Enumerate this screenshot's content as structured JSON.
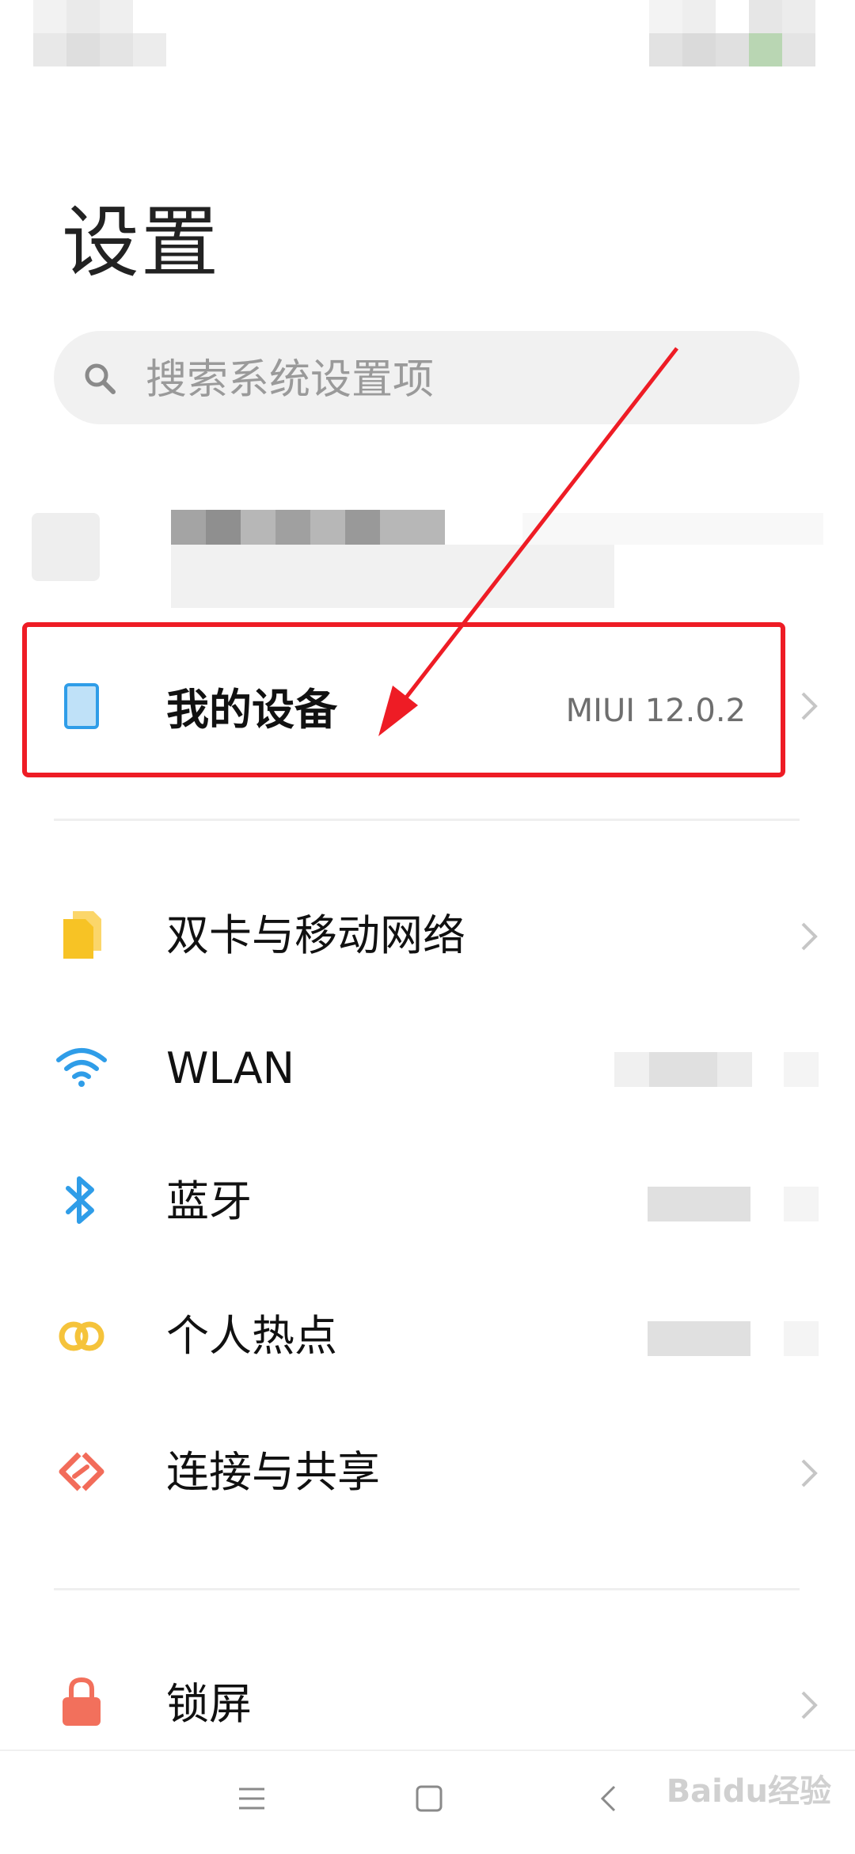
{
  "title": "设置",
  "search": {
    "placeholder": "搜索系统设置项"
  },
  "my_device": {
    "label": "我的设备",
    "value": "MIUI 12.0.2"
  },
  "items": [
    {
      "label": "双卡与移动网络",
      "icon": "sim-cards-icon"
    },
    {
      "label": "WLAN",
      "icon": "wifi-icon"
    },
    {
      "label": "蓝牙",
      "icon": "bluetooth-icon"
    },
    {
      "label": "个人热点",
      "icon": "hotspot-icon"
    },
    {
      "label": "连接与共享",
      "icon": "connection-sharing-icon"
    },
    {
      "label": "锁屏",
      "icon": "lock-icon"
    }
  ],
  "watermark": "Baidu经验",
  "colors": {
    "accent_red": "#ee1c25",
    "wifi_blue": "#2f9de8",
    "sim_yellow": "#f7c325",
    "hotspot_yellow": "#f5c33b",
    "share_red": "#f26c5a",
    "lock_red": "#f2705c"
  }
}
